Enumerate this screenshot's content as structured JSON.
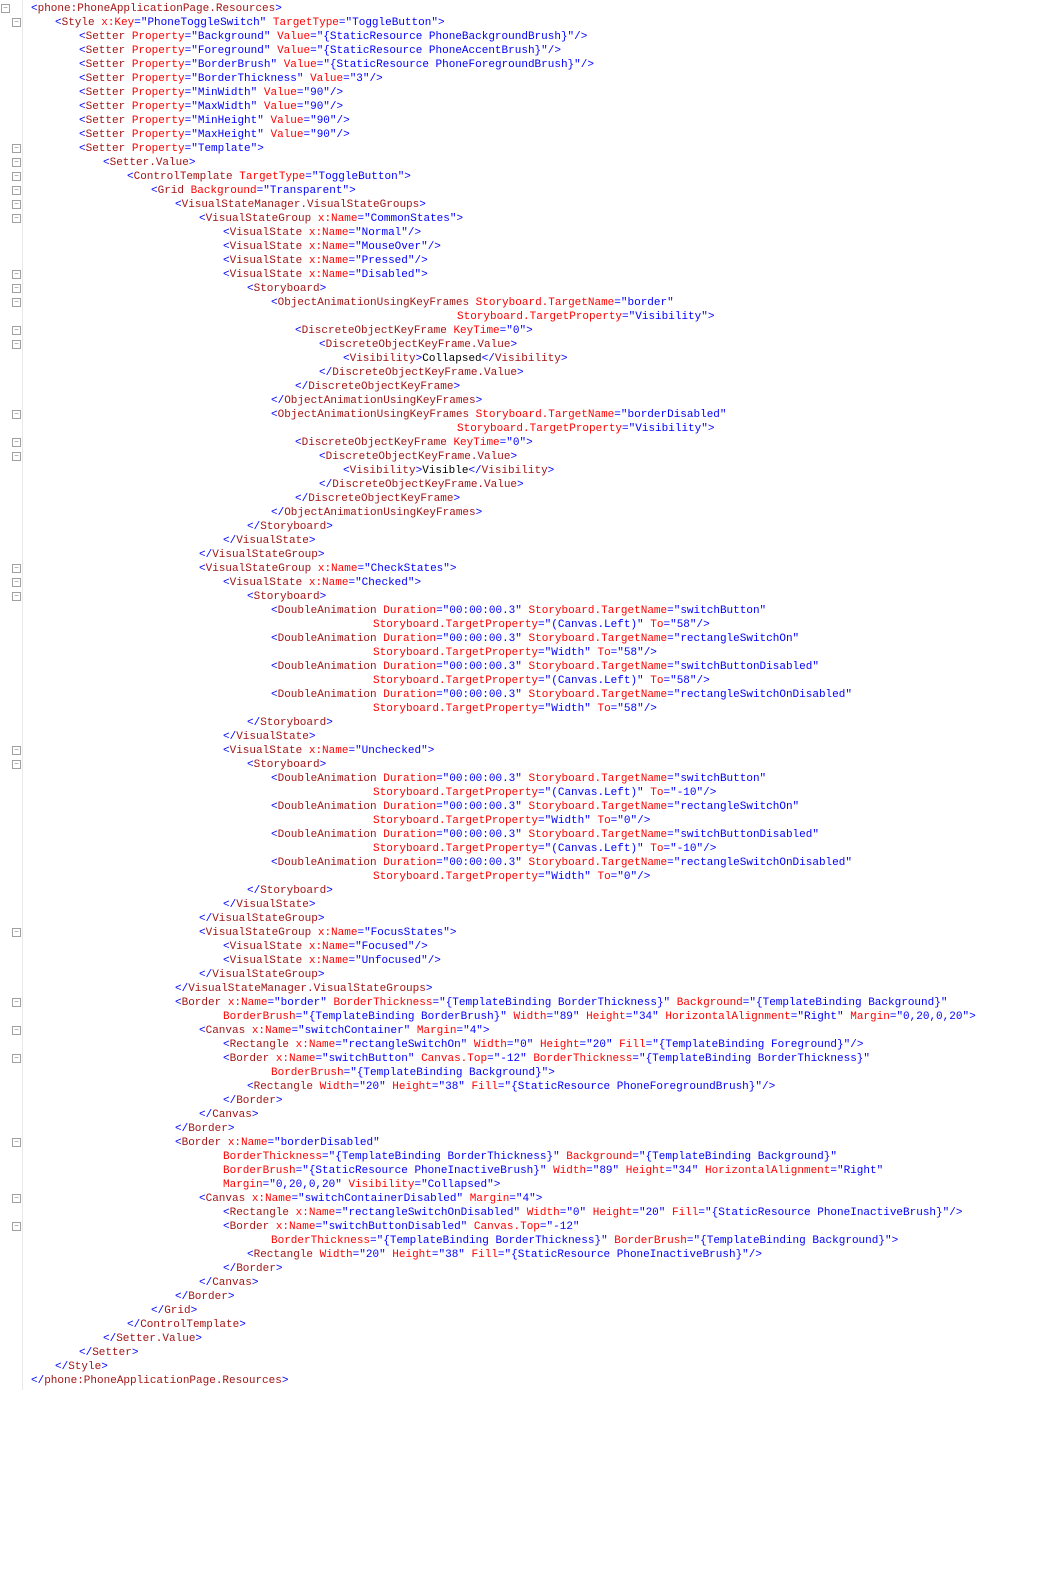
{
  "file": {
    "language": "XAML",
    "rootOpen": "phone:PhoneApplicationPage.Resources",
    "rootClose": "phone:PhoneApplicationPage.Resources"
  },
  "style": {
    "element": "Style",
    "attrs": {
      "x:Key": "PhoneToggleSwitch",
      "TargetType": "ToggleButton"
    },
    "setters": [
      {
        "Property": "Background",
        "Value": "{StaticResource PhoneBackgroundBrush}"
      },
      {
        "Property": "Foreground",
        "Value": "{StaticResource PhoneAccentBrush}"
      },
      {
        "Property": "BorderBrush",
        "Value": "{StaticResource PhoneForegroundBrush}"
      },
      {
        "Property": "BorderThickness",
        "Value": "3"
      },
      {
        "Property": "MinWidth",
        "Value": "90"
      },
      {
        "Property": "MaxWidth",
        "Value": "90"
      },
      {
        "Property": "MinHeight",
        "Value": "90"
      },
      {
        "Property": "MaxHeight",
        "Value": "90"
      },
      {
        "Property": "Template"
      }
    ]
  },
  "template": {
    "element": "ControlTemplate",
    "TargetType": "ToggleButton",
    "gridBackground": "Transparent",
    "vsmElement": "VisualStateManager.VisualStateGroups"
  },
  "commonStates": {
    "groupName": "CommonStates",
    "states": [
      "Normal",
      "MouseOver",
      "Pressed",
      "Disabled"
    ],
    "disabledStoryboard": {
      "animType": "ObjectAnimationUsingKeyFrames",
      "keyFrameType": "DiscreteObjectKeyFrame",
      "valueWrap": "DiscreteObjectKeyFrame.Value",
      "visElem": "Visibility",
      "frames": [
        {
          "TargetName": "border",
          "TargetProperty": "Visibility",
          "KeyTime": "0",
          "Visibility": "Collapsed"
        },
        {
          "TargetName": "borderDisabled",
          "TargetProperty": "Visibility",
          "KeyTime": "0",
          "Visibility": "Visible"
        }
      ]
    }
  },
  "checkStates": {
    "groupName": "CheckStates",
    "checked": {
      "name": "Checked",
      "anim": [
        {
          "Duration": "00:00:00.3",
          "TargetName": "switchButton",
          "TargetProperty": "(Canvas.Left)",
          "To": "58"
        },
        {
          "Duration": "00:00:00.3",
          "TargetName": "rectangleSwitchOn",
          "TargetProperty": "Width",
          "To": "58"
        },
        {
          "Duration": "00:00:00.3",
          "TargetName": "switchButtonDisabled",
          "TargetProperty": "(Canvas.Left)",
          "To": "58"
        },
        {
          "Duration": "00:00:00.3",
          "TargetName": "rectangleSwitchOnDisabled",
          "TargetProperty": "Width",
          "To": "58"
        }
      ]
    },
    "unchecked": {
      "name": "Unchecked",
      "anim": [
        {
          "Duration": "00:00:00.3",
          "TargetName": "switchButton",
          "TargetProperty": "(Canvas.Left)",
          "To": "-10"
        },
        {
          "Duration": "00:00:00.3",
          "TargetName": "rectangleSwitchOn",
          "TargetProperty": "Width",
          "To": "0"
        },
        {
          "Duration": "00:00:00.3",
          "TargetName": "switchButtonDisabled",
          "TargetProperty": "(Canvas.Left)",
          "To": "-10"
        },
        {
          "Duration": "00:00:00.3",
          "TargetName": "rectangleSwitchOnDisabled",
          "TargetProperty": "Width",
          "To": "0"
        }
      ]
    }
  },
  "focusStates": {
    "groupName": "FocusStates",
    "states": [
      "Focused",
      "Unfocused"
    ]
  },
  "borderNormal": {
    "xName": "border",
    "BorderThickness": "{TemplateBinding BorderThickness}",
    "Background": "{TemplateBinding Background}",
    "BorderBrush": "{TemplateBinding BorderBrush}",
    "Width": "89",
    "Height": "34",
    "HorizontalAlignment": "Right",
    "Margin": "0,20,0,20",
    "canvas": {
      "xName": "switchContainer",
      "Margin": "4"
    },
    "rect": {
      "xName": "rectangleSwitchOn",
      "Width": "0",
      "Height": "20",
      "Fill": "{TemplateBinding Foreground}"
    },
    "innerBorder": {
      "xName": "switchButton",
      "CanvasTop": "-12",
      "BorderThickness": "{TemplateBinding BorderThickness}",
      "BorderBrush": "{TemplateBinding Background}",
      "innerRect": {
        "Width": "20",
        "Height": "38",
        "Fill": "{StaticResource PhoneForegroundBrush}"
      }
    }
  },
  "borderDisabled": {
    "xName": "borderDisabled",
    "BorderThickness": "{TemplateBinding BorderThickness}",
    "Background": "{TemplateBinding Background}",
    "BorderBrush": "{StaticResource PhoneInactiveBrush}",
    "Width": "89",
    "Height": "34",
    "HorizontalAlignment": "Right",
    "Margin": "0,20,0,20",
    "Visibility": "Collapsed",
    "canvas": {
      "xName": "switchContainerDisabled",
      "Margin": "4"
    },
    "rect": {
      "xName": "rectangleSwitchOnDisabled",
      "Width": "0",
      "Height": "20",
      "Fill": "{StaticResource PhoneInactiveBrush}"
    },
    "innerBorder": {
      "xName": "switchButtonDisabled",
      "CanvasTop": "-12",
      "BorderThickness": "{TemplateBinding BorderThickness}",
      "BorderBrush": "{TemplateBinding Background}",
      "innerRect": {
        "Width": "20",
        "Height": "38",
        "Fill": "{StaticResource PhoneInactiveBrush}"
      }
    }
  }
}
